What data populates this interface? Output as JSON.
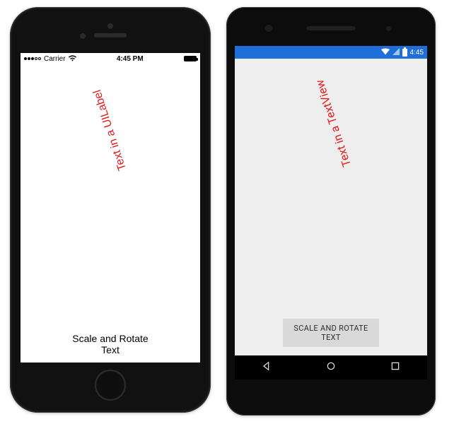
{
  "ios": {
    "statusbar": {
      "carrier": "Carrier",
      "time": "4:45 PM"
    },
    "rotated_text": "Text in a UILabel",
    "button_label": "Scale and Rotate Text"
  },
  "android": {
    "statusbar": {
      "time": "4:45"
    },
    "rotated_text": "Text in a TextView",
    "button_label": "SCALE AND ROTATE TEXT"
  }
}
